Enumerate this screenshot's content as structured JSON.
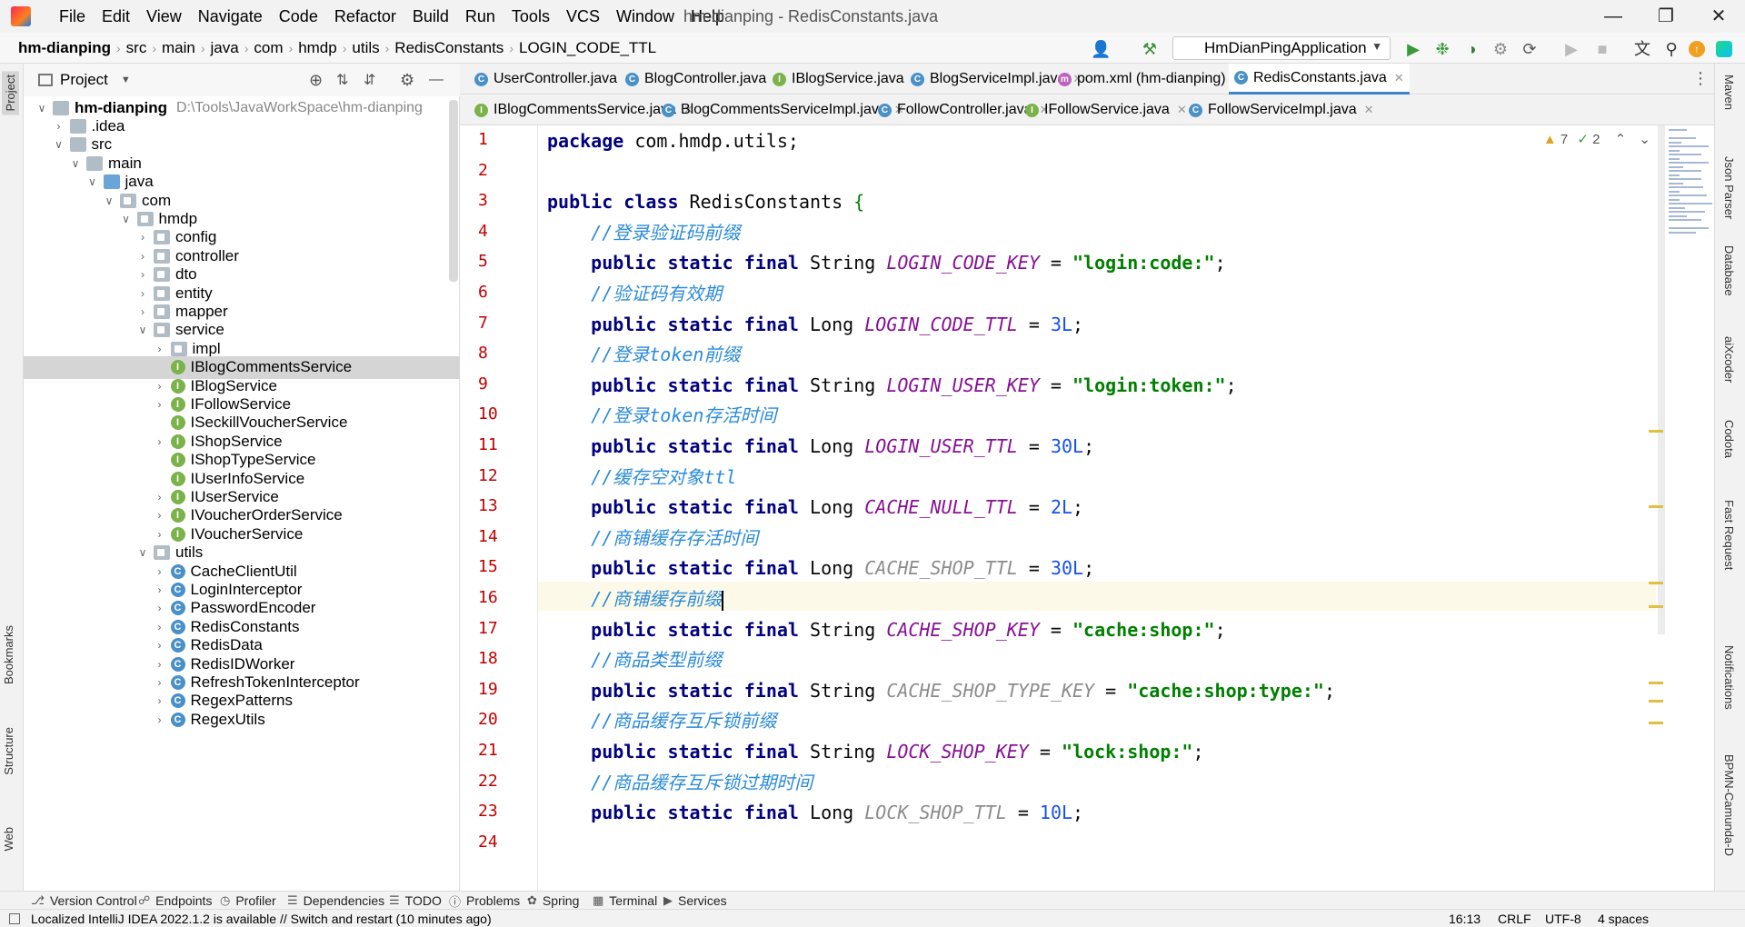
{
  "app": {
    "menu": [
      "File",
      "Edit",
      "View",
      "Navigate",
      "Code",
      "Refactor",
      "Build",
      "Run",
      "Tools",
      "VCS",
      "Window",
      "Help"
    ],
    "window_title": "hm-dianping - RedisConstants.java"
  },
  "navbar": {
    "breadcrumb": [
      "hm-dianping",
      "src",
      "main",
      "java",
      "com",
      "hmdp",
      "utils",
      "RedisConstants",
      "LOGIN_CODE_TTL"
    ],
    "run_config": "HmDianPingApplication"
  },
  "left_stripe": [
    "Project",
    "Bookmarks",
    "Structure",
    "Web"
  ],
  "project_panel": {
    "title": "Project",
    "tree": [
      {
        "label": "hm-dianping",
        "hint": "D:\\Tools\\JavaWorkSpace\\hm-dianping",
        "depth": 0,
        "arrow": "v",
        "icon": "folder",
        "bold": true
      },
      {
        "label": ".idea",
        "depth": 1,
        "arrow": ">",
        "icon": "folder"
      },
      {
        "label": "src",
        "depth": 1,
        "arrow": "v",
        "icon": "folder"
      },
      {
        "label": "main",
        "depth": 2,
        "arrow": "v",
        "icon": "folder"
      },
      {
        "label": "java",
        "depth": 3,
        "arrow": "v",
        "icon": "folder-blue"
      },
      {
        "label": "com",
        "depth": 4,
        "arrow": "v",
        "icon": "pkg"
      },
      {
        "label": "hmdp",
        "depth": 5,
        "arrow": "v",
        "icon": "pkg"
      },
      {
        "label": "config",
        "depth": 6,
        "arrow": ">",
        "icon": "pkg"
      },
      {
        "label": "controller",
        "depth": 6,
        "arrow": ">",
        "icon": "pkg"
      },
      {
        "label": "dto",
        "depth": 6,
        "arrow": ">",
        "icon": "pkg"
      },
      {
        "label": "entity",
        "depth": 6,
        "arrow": ">",
        "icon": "pkg"
      },
      {
        "label": "mapper",
        "depth": 6,
        "arrow": ">",
        "icon": "pkg"
      },
      {
        "label": "service",
        "depth": 6,
        "arrow": "v",
        "icon": "pkg"
      },
      {
        "label": "impl",
        "depth": 7,
        "arrow": ">",
        "icon": "pkg"
      },
      {
        "label": "IBlogCommentsService",
        "depth": 7,
        "arrow": "",
        "icon": "iface",
        "selected": true
      },
      {
        "label": "IBlogService",
        "depth": 7,
        "arrow": ">",
        "icon": "iface"
      },
      {
        "label": "IFollowService",
        "depth": 7,
        "arrow": ">",
        "icon": "iface"
      },
      {
        "label": "ISeckillVoucherService",
        "depth": 7,
        "arrow": "",
        "icon": "iface"
      },
      {
        "label": "IShopService",
        "depth": 7,
        "arrow": ">",
        "icon": "iface"
      },
      {
        "label": "IShopTypeService",
        "depth": 7,
        "arrow": "",
        "icon": "iface"
      },
      {
        "label": "IUserInfoService",
        "depth": 7,
        "arrow": "",
        "icon": "iface"
      },
      {
        "label": "IUserService",
        "depth": 7,
        "arrow": ">",
        "icon": "iface"
      },
      {
        "label": "IVoucherOrderService",
        "depth": 7,
        "arrow": ">",
        "icon": "iface"
      },
      {
        "label": "IVoucherService",
        "depth": 7,
        "arrow": ">",
        "icon": "iface"
      },
      {
        "label": "utils",
        "depth": 6,
        "arrow": "v",
        "icon": "pkg"
      },
      {
        "label": "CacheClientUtil",
        "depth": 7,
        "arrow": ">",
        "icon": "cls"
      },
      {
        "label": "LoginInterceptor",
        "depth": 7,
        "arrow": ">",
        "icon": "cls"
      },
      {
        "label": "PasswordEncoder",
        "depth": 7,
        "arrow": ">",
        "icon": "cls"
      },
      {
        "label": "RedisConstants",
        "depth": 7,
        "arrow": ">",
        "icon": "cls"
      },
      {
        "label": "RedisData",
        "depth": 7,
        "arrow": ">",
        "icon": "cls"
      },
      {
        "label": "RedisIDWorker",
        "depth": 7,
        "arrow": ">",
        "icon": "cls"
      },
      {
        "label": "RefreshTokenInterceptor",
        "depth": 7,
        "arrow": ">",
        "icon": "cls"
      },
      {
        "label": "RegexPatterns",
        "depth": 7,
        "arrow": ">",
        "icon": "cls"
      },
      {
        "label": "RegexUtils",
        "depth": 7,
        "arrow": ">",
        "icon": "cls"
      }
    ]
  },
  "tabs_row1": [
    {
      "label": "UserController.java",
      "icon": "C",
      "color": "#4a90c8"
    },
    {
      "label": "BlogController.java",
      "icon": "C",
      "color": "#4a90c8"
    },
    {
      "label": "IBlogService.java",
      "icon": "I",
      "color": "#7bb24a"
    },
    {
      "label": "BlogServiceImpl.java",
      "icon": "C",
      "color": "#4a90c8"
    },
    {
      "label": "pom.xml (hm-dianping)",
      "icon": "m",
      "color": "#c060c0"
    },
    {
      "label": "RedisConstants.java",
      "icon": "C",
      "color": "#4a90c8",
      "active": true
    }
  ],
  "tabs_row2": [
    {
      "label": "IBlogCommentsService.java",
      "icon": "I",
      "color": "#7bb24a"
    },
    {
      "label": "BlogCommentsServiceImpl.java",
      "icon": "C",
      "color": "#4a90c8"
    },
    {
      "label": "FollowController.java",
      "icon": "C",
      "color": "#4a90c8"
    },
    {
      "label": "IFollowService.java",
      "icon": "I",
      "color": "#7bb24a"
    },
    {
      "label": "FollowServiceImpl.java",
      "icon": "C",
      "color": "#4a90c8"
    }
  ],
  "editor": {
    "inspections": {
      "warnings": "7",
      "weak_warnings": "2"
    },
    "line_numbers": [
      "1",
      "2",
      "3",
      "4",
      "5",
      "6",
      "7",
      "8",
      "9",
      "10",
      "11",
      "12",
      "13",
      "14",
      "15",
      "16",
      "17",
      "18",
      "19",
      "20",
      "21",
      "22",
      "23",
      "24"
    ],
    "lines": [
      {
        "t": "package com.hmdp.utils;"
      },
      {
        "t": ""
      },
      {
        "t": "public class RedisConstants {"
      },
      {
        "t": "    //登录验证码前缀"
      },
      {
        "t": "    public static final String LOGIN_CODE_KEY = \"login:code:\";"
      },
      {
        "t": "    //验证码有效期"
      },
      {
        "t": "    public static final Long LOGIN_CODE_TTL = 3L;"
      },
      {
        "t": "    //登录token前缀"
      },
      {
        "t": "    public static final String LOGIN_USER_KEY = \"login:token:\";"
      },
      {
        "t": "    //登录token存活时间"
      },
      {
        "t": "    public static final Long LOGIN_USER_TTL = 30L;"
      },
      {
        "t": "    //缓存空对象ttl"
      },
      {
        "t": "    public static final Long CACHE_NULL_TTL = 2L;"
      },
      {
        "t": "    //商铺缓存存活时间"
      },
      {
        "t": "    public static final Long CACHE_SHOP_TTL = 30L;"
      },
      {
        "t": "    //商铺缓存前缀"
      },
      {
        "t": "    public static final String CACHE_SHOP_KEY = \"cache:shop:\";"
      },
      {
        "t": "    //商品类型前缀"
      },
      {
        "t": "    public static final String CACHE_SHOP_TYPE_KEY = \"cache:shop:type:\";"
      },
      {
        "t": "    //商品缓存互斥锁前缀"
      },
      {
        "t": "    public static final String LOCK_SHOP_KEY = \"lock:shop:\";"
      },
      {
        "t": "    //商品缓存互斥锁过期时间"
      },
      {
        "t": "    public static final Long LOCK_SHOP_TTL = 10L;"
      },
      {
        "t": ""
      }
    ]
  },
  "right_stripe": [
    "Maven",
    "Json Parser",
    "Database",
    "aiXcoder",
    "Codota",
    "Fast Request",
    "Notifications",
    "BPMN-Camunda-D"
  ],
  "bottom_tools": [
    "Version Control",
    "Endpoints",
    "Profiler",
    "Dependencies",
    "TODO",
    "Problems",
    "Spring",
    "Terminal",
    "Services"
  ],
  "status": {
    "message": "Localized IntelliJ IDEA 2022.1.2 is available // Switch and restart (10 minutes ago)",
    "position": "16:13",
    "line_sep": "CRLF",
    "encoding": "UTF-8",
    "indent": "4 spaces"
  }
}
